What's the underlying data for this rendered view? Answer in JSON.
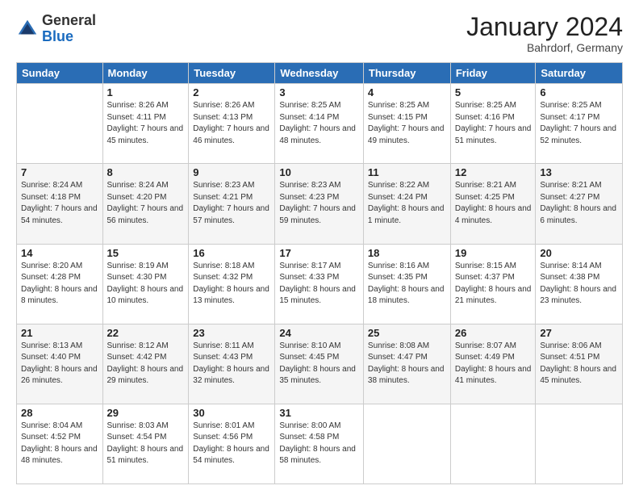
{
  "logo": {
    "general": "General",
    "blue": "Blue"
  },
  "header": {
    "month": "January 2024",
    "location": "Bahrdorf, Germany"
  },
  "weekdays": [
    "Sunday",
    "Monday",
    "Tuesday",
    "Wednesday",
    "Thursday",
    "Friday",
    "Saturday"
  ],
  "weeks": [
    [
      {
        "day": "",
        "sunrise": "",
        "sunset": "",
        "daylight": ""
      },
      {
        "day": "1",
        "sunrise": "Sunrise: 8:26 AM",
        "sunset": "Sunset: 4:11 PM",
        "daylight": "Daylight: 7 hours and 45 minutes."
      },
      {
        "day": "2",
        "sunrise": "Sunrise: 8:26 AM",
        "sunset": "Sunset: 4:13 PM",
        "daylight": "Daylight: 7 hours and 46 minutes."
      },
      {
        "day": "3",
        "sunrise": "Sunrise: 8:25 AM",
        "sunset": "Sunset: 4:14 PM",
        "daylight": "Daylight: 7 hours and 48 minutes."
      },
      {
        "day": "4",
        "sunrise": "Sunrise: 8:25 AM",
        "sunset": "Sunset: 4:15 PM",
        "daylight": "Daylight: 7 hours and 49 minutes."
      },
      {
        "day": "5",
        "sunrise": "Sunrise: 8:25 AM",
        "sunset": "Sunset: 4:16 PM",
        "daylight": "Daylight: 7 hours and 51 minutes."
      },
      {
        "day": "6",
        "sunrise": "Sunrise: 8:25 AM",
        "sunset": "Sunset: 4:17 PM",
        "daylight": "Daylight: 7 hours and 52 minutes."
      }
    ],
    [
      {
        "day": "7",
        "sunrise": "Sunrise: 8:24 AM",
        "sunset": "Sunset: 4:18 PM",
        "daylight": "Daylight: 7 hours and 54 minutes."
      },
      {
        "day": "8",
        "sunrise": "Sunrise: 8:24 AM",
        "sunset": "Sunset: 4:20 PM",
        "daylight": "Daylight: 7 hours and 56 minutes."
      },
      {
        "day": "9",
        "sunrise": "Sunrise: 8:23 AM",
        "sunset": "Sunset: 4:21 PM",
        "daylight": "Daylight: 7 hours and 57 minutes."
      },
      {
        "day": "10",
        "sunrise": "Sunrise: 8:23 AM",
        "sunset": "Sunset: 4:23 PM",
        "daylight": "Daylight: 7 hours and 59 minutes."
      },
      {
        "day": "11",
        "sunrise": "Sunrise: 8:22 AM",
        "sunset": "Sunset: 4:24 PM",
        "daylight": "Daylight: 8 hours and 1 minute."
      },
      {
        "day": "12",
        "sunrise": "Sunrise: 8:21 AM",
        "sunset": "Sunset: 4:25 PM",
        "daylight": "Daylight: 8 hours and 4 minutes."
      },
      {
        "day": "13",
        "sunrise": "Sunrise: 8:21 AM",
        "sunset": "Sunset: 4:27 PM",
        "daylight": "Daylight: 8 hours and 6 minutes."
      }
    ],
    [
      {
        "day": "14",
        "sunrise": "Sunrise: 8:20 AM",
        "sunset": "Sunset: 4:28 PM",
        "daylight": "Daylight: 8 hours and 8 minutes."
      },
      {
        "day": "15",
        "sunrise": "Sunrise: 8:19 AM",
        "sunset": "Sunset: 4:30 PM",
        "daylight": "Daylight: 8 hours and 10 minutes."
      },
      {
        "day": "16",
        "sunrise": "Sunrise: 8:18 AM",
        "sunset": "Sunset: 4:32 PM",
        "daylight": "Daylight: 8 hours and 13 minutes."
      },
      {
        "day": "17",
        "sunrise": "Sunrise: 8:17 AM",
        "sunset": "Sunset: 4:33 PM",
        "daylight": "Daylight: 8 hours and 15 minutes."
      },
      {
        "day": "18",
        "sunrise": "Sunrise: 8:16 AM",
        "sunset": "Sunset: 4:35 PM",
        "daylight": "Daylight: 8 hours and 18 minutes."
      },
      {
        "day": "19",
        "sunrise": "Sunrise: 8:15 AM",
        "sunset": "Sunset: 4:37 PM",
        "daylight": "Daylight: 8 hours and 21 minutes."
      },
      {
        "day": "20",
        "sunrise": "Sunrise: 8:14 AM",
        "sunset": "Sunset: 4:38 PM",
        "daylight": "Daylight: 8 hours and 23 minutes."
      }
    ],
    [
      {
        "day": "21",
        "sunrise": "Sunrise: 8:13 AM",
        "sunset": "Sunset: 4:40 PM",
        "daylight": "Daylight: 8 hours and 26 minutes."
      },
      {
        "day": "22",
        "sunrise": "Sunrise: 8:12 AM",
        "sunset": "Sunset: 4:42 PM",
        "daylight": "Daylight: 8 hours and 29 minutes."
      },
      {
        "day": "23",
        "sunrise": "Sunrise: 8:11 AM",
        "sunset": "Sunset: 4:43 PM",
        "daylight": "Daylight: 8 hours and 32 minutes."
      },
      {
        "day": "24",
        "sunrise": "Sunrise: 8:10 AM",
        "sunset": "Sunset: 4:45 PM",
        "daylight": "Daylight: 8 hours and 35 minutes."
      },
      {
        "day": "25",
        "sunrise": "Sunrise: 8:08 AM",
        "sunset": "Sunset: 4:47 PM",
        "daylight": "Daylight: 8 hours and 38 minutes."
      },
      {
        "day": "26",
        "sunrise": "Sunrise: 8:07 AM",
        "sunset": "Sunset: 4:49 PM",
        "daylight": "Daylight: 8 hours and 41 minutes."
      },
      {
        "day": "27",
        "sunrise": "Sunrise: 8:06 AM",
        "sunset": "Sunset: 4:51 PM",
        "daylight": "Daylight: 8 hours and 45 minutes."
      }
    ],
    [
      {
        "day": "28",
        "sunrise": "Sunrise: 8:04 AM",
        "sunset": "Sunset: 4:52 PM",
        "daylight": "Daylight: 8 hours and 48 minutes."
      },
      {
        "day": "29",
        "sunrise": "Sunrise: 8:03 AM",
        "sunset": "Sunset: 4:54 PM",
        "daylight": "Daylight: 8 hours and 51 minutes."
      },
      {
        "day": "30",
        "sunrise": "Sunrise: 8:01 AM",
        "sunset": "Sunset: 4:56 PM",
        "daylight": "Daylight: 8 hours and 54 minutes."
      },
      {
        "day": "31",
        "sunrise": "Sunrise: 8:00 AM",
        "sunset": "Sunset: 4:58 PM",
        "daylight": "Daylight: 8 hours and 58 minutes."
      },
      {
        "day": "",
        "sunrise": "",
        "sunset": "",
        "daylight": ""
      },
      {
        "day": "",
        "sunrise": "",
        "sunset": "",
        "daylight": ""
      },
      {
        "day": "",
        "sunrise": "",
        "sunset": "",
        "daylight": ""
      }
    ]
  ]
}
